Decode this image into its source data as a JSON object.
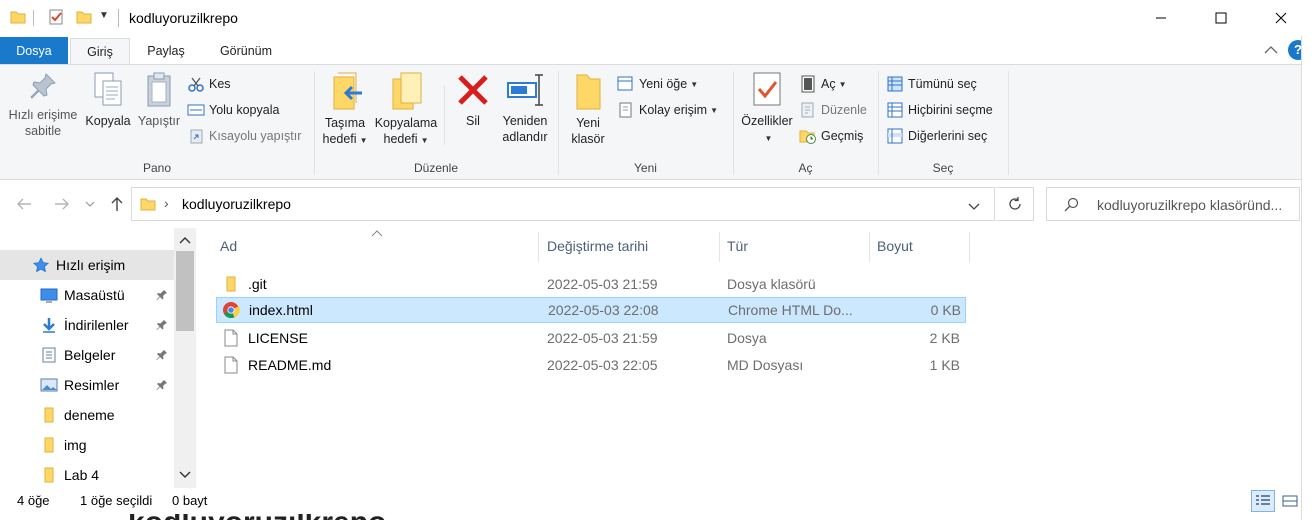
{
  "window": {
    "title": "kodluyoruzilkrepo"
  },
  "ribbon_tabs": [
    "Dosya",
    "Giriş",
    "Paylaş",
    "Görünüm"
  ],
  "ribbon": {
    "pano": {
      "label": "Pano",
      "pin_line1": "Hızlı erişime",
      "pin_line2": "sabitle",
      "copy": "Kopyala",
      "paste": "Yapıştır",
      "cut": "Kes",
      "copy_path": "Yolu kopyala",
      "paste_shortcut": "Kısayolu yapıştır"
    },
    "duzenle": {
      "label": "Düzenle",
      "move_line1": "Taşıma",
      "move_line2": "hedefi",
      "copyto_line1": "Kopyalama",
      "copyto_line2": "hedefi",
      "delete": "Sil",
      "rename_line1": "Yeniden",
      "rename_line2": "adlandır"
    },
    "yeni": {
      "label": "Yeni",
      "newfolder_line1": "Yeni",
      "newfolder_line2": "klasör",
      "new_item": "Yeni öğe",
      "easy_access": "Kolay erişim"
    },
    "ac": {
      "label": "Aç",
      "properties": "Özellikler",
      "open": "Aç",
      "edit": "Düzenle",
      "history": "Geçmiş"
    },
    "sec": {
      "label": "Seç",
      "select_all": "Tümünü seç",
      "select_none": "Hiçbirini seçme",
      "invert": "Diğerlerini seç"
    }
  },
  "address": {
    "path": "kodluyoruzilkrepo",
    "search_placeholder": "kodluyoruzilkrepo klasöründ..."
  },
  "nav": {
    "quick_access": "Hızlı erişim",
    "items": [
      {
        "label": "Masaüstü",
        "icon": "desktop-icon"
      },
      {
        "label": "İndirilenler",
        "icon": "download-icon"
      },
      {
        "label": "Belgeler",
        "icon": "documents-icon"
      },
      {
        "label": "Resimler",
        "icon": "pictures-icon"
      },
      {
        "label": "deneme",
        "icon": "folder-icon"
      },
      {
        "label": "img",
        "icon": "folder-icon"
      },
      {
        "label": "Lab 4",
        "icon": "folder-icon"
      }
    ]
  },
  "columns": {
    "name": "Ad",
    "date": "Değiştirme tarihi",
    "type": "Tür",
    "size": "Boyut"
  },
  "files": [
    {
      "name": ".git",
      "date": "2022-05-03 21:59",
      "type": "Dosya klasörü",
      "size": "",
      "icon": "folder-icon"
    },
    {
      "name": "index.html",
      "date": "2022-05-03 22:08",
      "type": "Chrome HTML Do...",
      "size": "0 KB",
      "icon": "chrome-icon"
    },
    {
      "name": "LICENSE",
      "date": "2022-05-03 21:59",
      "type": "Dosya",
      "size": "2 KB",
      "icon": "file-icon"
    },
    {
      "name": "README.md",
      "date": "2022-05-03 22:05",
      "type": "MD Dosyası",
      "size": "1 KB",
      "icon": "file-icon"
    }
  ],
  "status": {
    "count": "4 öğe",
    "selected": "1 öğe seçildi",
    "size": "0 bayt"
  },
  "background_text": "kodluyoruzilkrepo",
  "colors": {
    "accent": "#1979ca",
    "selection": "#cce8ff",
    "folder": "#ffd767"
  }
}
